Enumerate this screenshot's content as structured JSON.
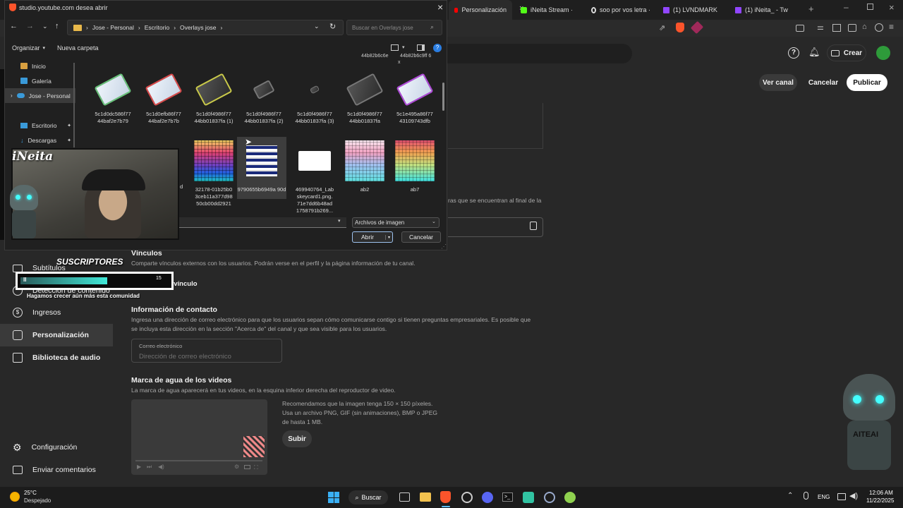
{
  "browser": {
    "tabs": [
      {
        "label": "Personalización",
        "icon": "youtube-icon"
      },
      {
        "label": "iNeita Stream ·",
        "icon": "kick-icon"
      },
      {
        "label": "soo por vos letra ·",
        "icon": "google-icon"
      },
      {
        "label": "(1) LVNDMARK",
        "icon": "twitch-icon"
      },
      {
        "label": "(1) iNeita_ - Tw",
        "icon": "twitch-icon"
      }
    ]
  },
  "yt": {
    "create_label": "Crear",
    "ver_canal": "Ver canal",
    "cancelar": "Cancelar",
    "publicar": "Publicar",
    "partial_text": "ras que se encuentran al final de la",
    "links_title": "Vínculos",
    "links_desc": "Comparte vínculos externos con los usuarios. Podrán verse en el perfil y la página información de tu canal.",
    "add_link": "Agregar vínculo",
    "contact_title": "Información de contacto",
    "contact_desc_1": "Ingresa una dirección de correo electrónico para que los usuarios sepan cómo comunicarse contigo si tienen preguntas empresariales. Es posible que",
    "contact_desc_2": "se incluya esta dirección en la sección \"Acerca de\" del canal y que sea visible para los usuarios.",
    "email_label": "Correo electrónico",
    "email_placeholder": "Dirección de correo electrónico",
    "watermark_title": "Marca de agua de los videos",
    "watermark_desc": "La marca de agua aparecerá en tus videos, en la esquina inferior derecha del reproductor de video.",
    "watermark_hint_1": "Recomendamos que la imagen tenga 150 × 150 píxeles.",
    "watermark_hint_2": "Usa un archivo PNG, GIF (sin animaciones), BMP o JPEG",
    "watermark_hint_3": "de hasta 1 MB.",
    "upload": "Subir"
  },
  "sidebar": {
    "items": [
      {
        "label": "Subtítulos",
        "icon": "subtitles-icon"
      },
      {
        "label": "Detección de contenido",
        "icon": "copyright-icon"
      },
      {
        "label": "Ingresos",
        "icon": "money-icon"
      },
      {
        "label": "Personalización",
        "icon": "brush-icon"
      },
      {
        "label": "Biblioteca de audio",
        "icon": "audio-library-icon"
      }
    ],
    "bottom": [
      {
        "label": "Configuración",
        "icon": "gear-icon"
      },
      {
        "label": "Enviar comentarios",
        "icon": "feedback-icon"
      }
    ]
  },
  "dialog": {
    "title": "studio.youtube.com desea abrir",
    "breadcrumb": [
      "Jose - Personal",
      "Escritorio",
      "Overlays jose"
    ],
    "search_placeholder": "Buscar en Overlays jose",
    "organize": "Organizar",
    "new_folder": "Nueva carpeta",
    "nav": [
      {
        "label": "Inicio",
        "icon": "home-icon"
      },
      {
        "label": "Galería",
        "icon": "gallery-icon"
      },
      {
        "label": "Jose - Personal",
        "icon": "cloud-icon"
      },
      {
        "label": "Escritorio",
        "icon": "desktop-icon"
      },
      {
        "label": "Descargas",
        "icon": "download-icon"
      }
    ],
    "top_partial": [
      "44b82b6c6e",
      "44b82b6c9ff 6",
      "x"
    ],
    "files_row1": [
      "5c1d0dc586f77 44baf2e7b79",
      "5c1d0efb86f77 44baf2e7b7b",
      "5c1d0f4986f77 44bb01837fa (1)",
      "5c1d0f4986f77 44bb01837fa (2)",
      "5c1d0f4986f77 44bb01837fa (3)",
      "5c1d0f4986f77 44bb01837fa",
      "5c1e495a86f77 43109743dfb"
    ],
    "files_row2": [
      "d",
      "32178-01b25b0 3ceb11a377d98 50cb00dd2921",
      "9790655b6949a 90d",
      "469940764_Lab skeycard1.png. 71e7dd6b48ad 1758791b269...",
      "ab2",
      "ab7"
    ],
    "file_type": "Archivos de imagen",
    "open": "Abrir",
    "cancel": "Cancelar"
  },
  "overlay": {
    "streamer": "iNeita",
    "subs_title": "SUSCRIPTORES",
    "subs_progress": 0.58,
    "subs_count": "15",
    "subs_tagline": "Hagamos crecer aún más esta comunidad",
    "subs_pause": "II",
    "mascot_text": "AITEAI"
  },
  "taskbar": {
    "weather_temp": "25°C",
    "weather_desc": "Despejado",
    "search": "Buscar",
    "lang": "ENG",
    "time": "12:06 AM",
    "date": "11/22/2025"
  }
}
